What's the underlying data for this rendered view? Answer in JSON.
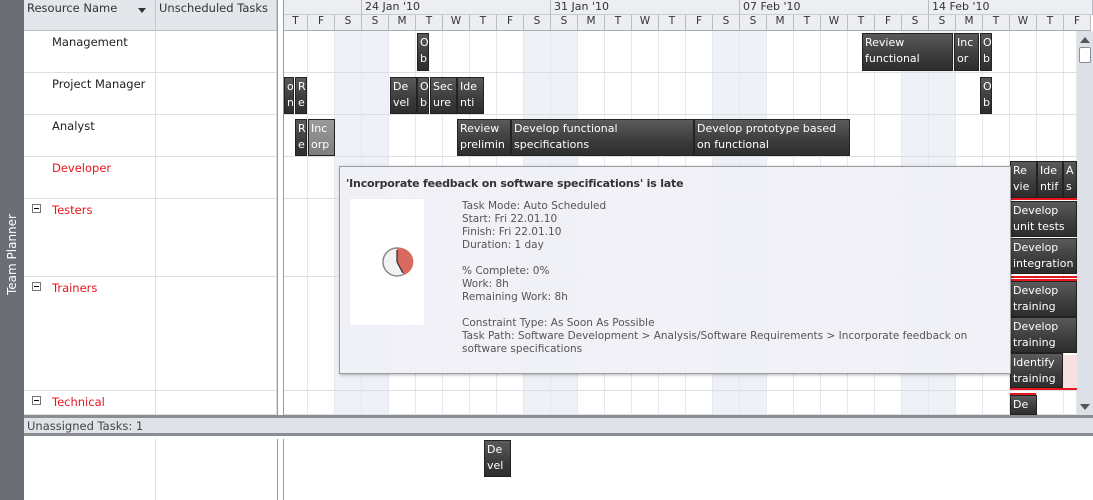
{
  "sidebar_label": "Team Planner",
  "columns": {
    "resource_name": "Resource Name",
    "unscheduled": "Unscheduled Tasks"
  },
  "timeline": {
    "weeks": [
      "24 Jan '10",
      "31 Jan '10",
      "07 Feb '10",
      "14 Feb '10"
    ],
    "days": [
      "T",
      "F",
      "S",
      "S",
      "M",
      "T",
      "W",
      "T",
      "F",
      "S",
      "S",
      "M",
      "T",
      "W",
      "T",
      "F",
      "S",
      "S",
      "M",
      "T",
      "W",
      "T",
      "F",
      "S",
      "S",
      "M",
      "T",
      "W",
      "T",
      "F"
    ]
  },
  "resources": [
    {
      "name": "Management",
      "overallocated": false,
      "group": false
    },
    {
      "name": "Project Manager",
      "overallocated": false,
      "group": false
    },
    {
      "name": "Analyst",
      "overallocated": false,
      "group": false
    },
    {
      "name": "Developer",
      "overallocated": true,
      "group": false
    },
    {
      "name": "Testers",
      "overallocated": true,
      "group": true
    },
    {
      "name": "Trainers",
      "overallocated": true,
      "group": true
    },
    {
      "name": "Technical",
      "overallocated": true,
      "group": true
    }
  ],
  "tasks": [
    "Ob",
    "Review functional specifications",
    "Incor",
    "Ob",
    "o n",
    "Re",
    "Devel",
    "Ob",
    "Secure",
    "Identi",
    "Ob",
    "Re",
    "Incorp",
    "Review prelimin",
    "Develop functional specifications",
    "Develop prototype based on functional specifications",
    "Re vie",
    "Ide ntif",
    "As ig",
    "Develop unit tests using product",
    "Develop integration test plans using",
    "Develop training spe",
    "Develop training spe",
    "Identify training",
    "De"
  ],
  "unassigned": {
    "label": "Unassigned Tasks: 1",
    "tasks": [
      "Devel"
    ]
  },
  "tooltip": {
    "title": "'Incorporate feedback on software specifications' is late",
    "icon": "late-clock-icon",
    "lines": [
      "Task Mode: Auto Scheduled",
      "Start: Fri 22.01.10",
      "Finish: Fri 22.01.10",
      "Duration: 1 day",
      "",
      "% Complete: 0%",
      "Work: 8h",
      "Remaining Work: 8h",
      "",
      "Constraint Type: As Soon As Possible",
      "Task Path: Software Development > Analysis/Software Requirements > Incorporate feedback on software specifications"
    ]
  },
  "colors": {
    "overallocated": "#e8141e",
    "task_bar": "#3c3c3c",
    "late_task_bar": "#8a8a8a"
  }
}
